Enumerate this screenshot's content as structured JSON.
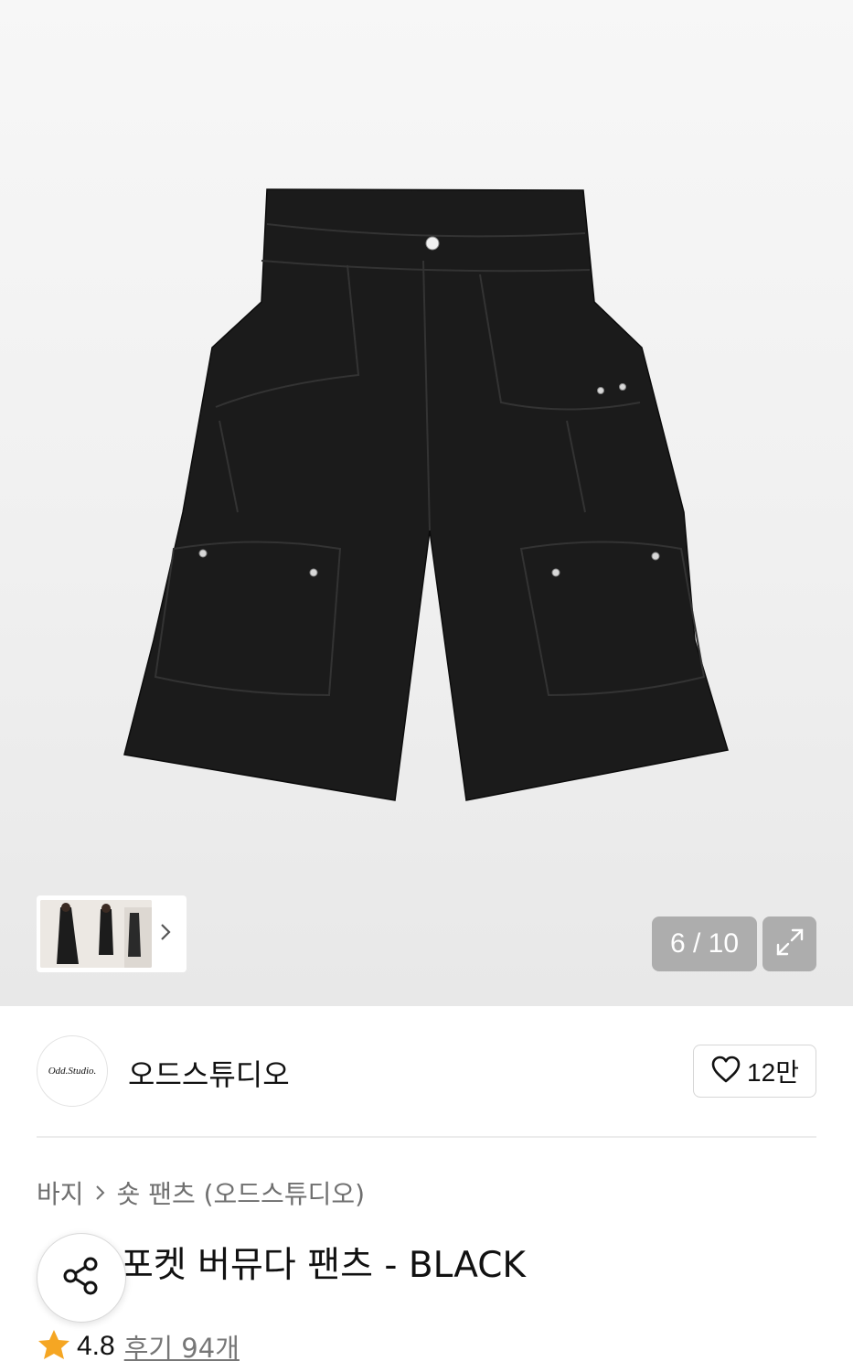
{
  "gallery": {
    "counter": "6 / 10",
    "product_color": "#1a1a1a"
  },
  "brand": {
    "logo_text": "Odd.Studio.",
    "name": "오드스튜디오"
  },
  "like": {
    "count": "12만"
  },
  "breadcrumb": {
    "category": "바지",
    "subcategory": "숏 팬츠 (오드스튜디오)"
  },
  "product": {
    "title": "포켓 버뮤다 팬츠 - BLACK",
    "rating": "4.8",
    "reviews": "후기 94개"
  },
  "colors": {
    "star": "#f5a623"
  }
}
